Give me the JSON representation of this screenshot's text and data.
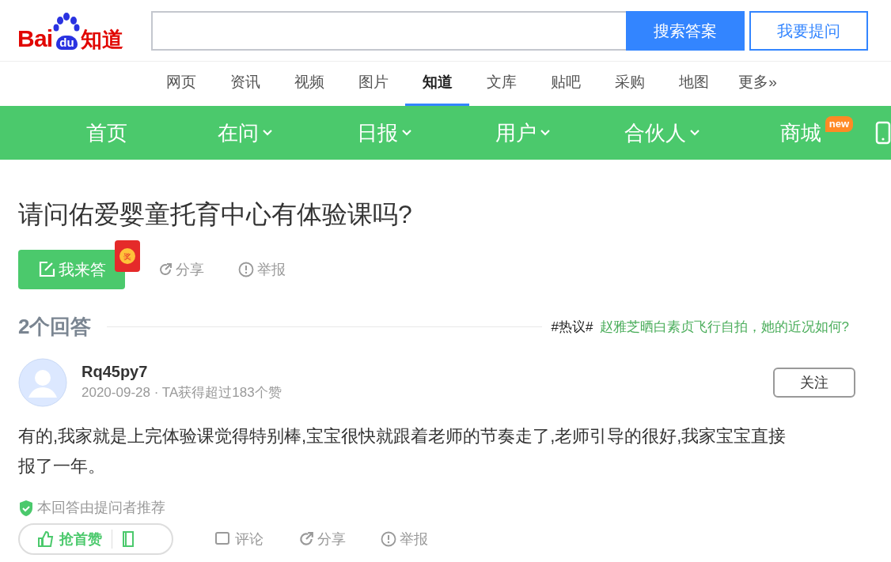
{
  "logo": {
    "brand": "Bai",
    "paw_text": "du",
    "product": "知道"
  },
  "search": {
    "button": "搜索答案",
    "ask_button": "我要提问"
  },
  "nav_tabs": [
    {
      "label": "网页",
      "selected": false
    },
    {
      "label": "资讯",
      "selected": false
    },
    {
      "label": "视频",
      "selected": false
    },
    {
      "label": "图片",
      "selected": false
    },
    {
      "label": "知道",
      "selected": true
    },
    {
      "label": "文库",
      "selected": false
    },
    {
      "label": "贴吧",
      "selected": false
    },
    {
      "label": "采购",
      "selected": false
    },
    {
      "label": "地图",
      "selected": false
    },
    {
      "label": "更多»",
      "selected": false
    }
  ],
  "menu": [
    {
      "label": "首页",
      "dropdown": false
    },
    {
      "label": "在问",
      "dropdown": true
    },
    {
      "label": "日报",
      "dropdown": true
    },
    {
      "label": "用户",
      "dropdown": true
    },
    {
      "label": "合伙人",
      "dropdown": true
    },
    {
      "label": "商城",
      "dropdown": false,
      "badge": "new"
    }
  ],
  "question": {
    "title": "请问佑爱婴童托育中心有体验课吗?",
    "answer_button": "我来答",
    "red_packet_text": "奖",
    "share": "分享",
    "report": "举报"
  },
  "answers_header": {
    "count": "2个回答",
    "hot_tag": "#热议#",
    "hot_link": "赵雅芝晒白素贞飞行自拍，她的近况如何?"
  },
  "answer": {
    "user": "Rq45py7",
    "meta": "2020-09-28 · TA获得超过183个赞",
    "follow": "关注",
    "text": "有的,我家就是上完体验课觉得特别棒,宝宝很快就跟着老师的节奏走了,老师引导的很好,我家宝宝直接报了一年。",
    "recommended": "本回答由提问者推荐",
    "like": "抢首赞",
    "comment": "评论",
    "share": "分享",
    "report": "举报"
  }
}
